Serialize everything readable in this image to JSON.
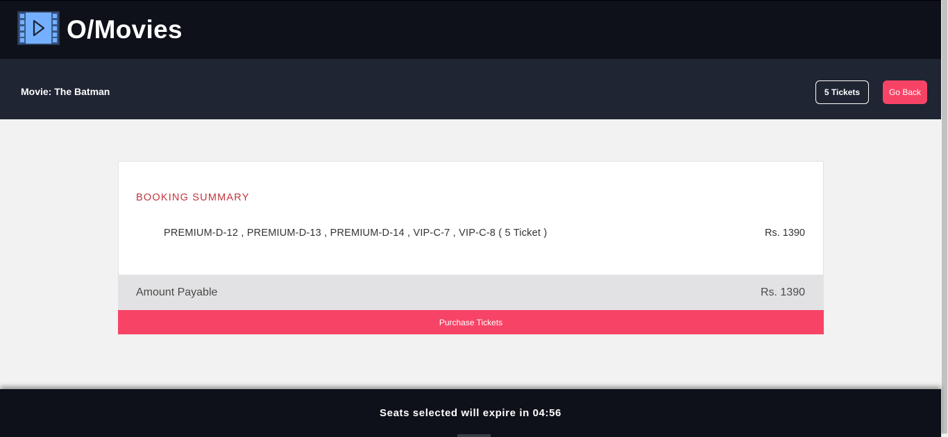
{
  "header": {
    "brand": "O/Movies",
    "logo_icon": "film-play-icon"
  },
  "subheader": {
    "movie_title": "Movie: The Batman",
    "tickets_label": "5 Tickets",
    "go_back_label": "Go Back"
  },
  "summary": {
    "title": "BOOKING SUMMARY",
    "seats_text": "PREMIUM-D-12 , PREMIUM-D-13 , PREMIUM-D-14 , VIP-C-7 , VIP-C-8 ( 5 Ticket )",
    "seats_price": "Rs. 1390",
    "payable_label": "Amount Payable",
    "payable_amount": "Rs. 1390",
    "purchase_label": "Purchase Tickets"
  },
  "footer": {
    "expiry_text": "Seats selected will expire in 04:56"
  },
  "colors": {
    "accent": "#f74466",
    "header_bg": "#0e111a",
    "subheader_bg": "#1f2533",
    "summary_title": "#c0343c",
    "logo_blue": "#74b0ff"
  }
}
